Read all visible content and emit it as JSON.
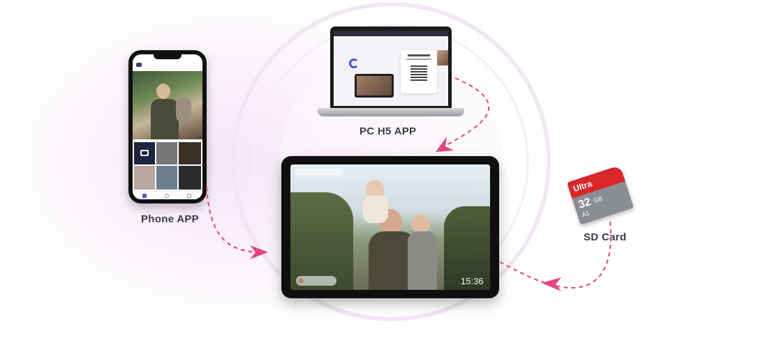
{
  "labels": {
    "phone": "Phone APP",
    "pc": "PC H5 APP",
    "sd": "SD Card"
  },
  "sdcard": {
    "brand": "Ultra",
    "capacity": "32",
    "unit": "GB",
    "class": "A1"
  },
  "tablet": {
    "clock": "15:36"
  },
  "colors": {
    "arrow": "#e2457f",
    "ring": "#f2e6f3",
    "sd_red": "#d9262b",
    "sd_gray": "#8a8d92"
  }
}
